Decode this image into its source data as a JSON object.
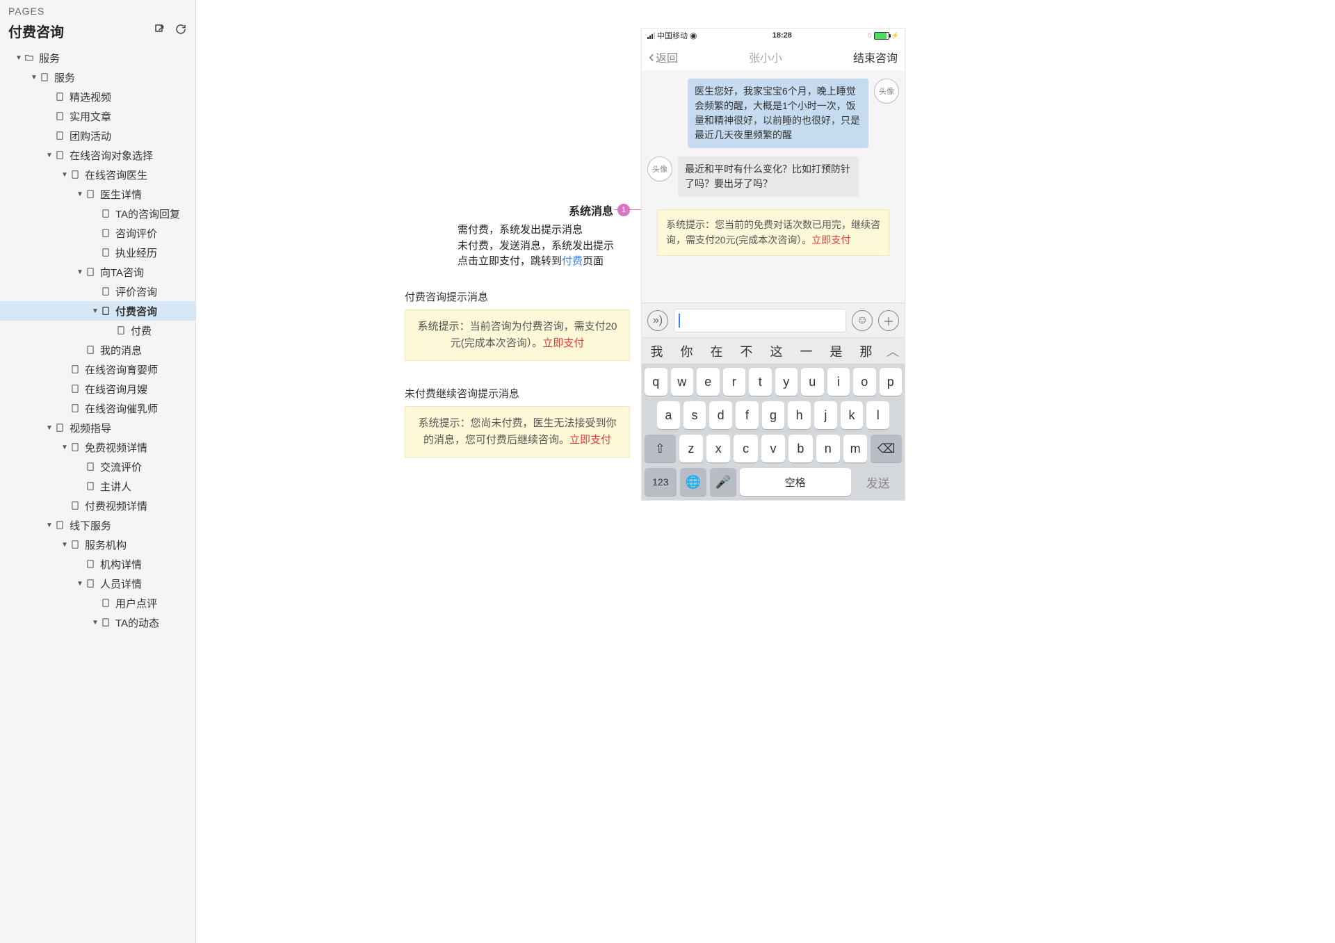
{
  "sidebar": {
    "pages_label": "PAGES",
    "title": "付费咨询",
    "tree": {
      "n0": "服务",
      "n1": "服务",
      "n2": "精选视频",
      "n3": "实用文章",
      "n4": "团购活动",
      "n5": "在线咨询对象选择",
      "n6": "在线咨询医生",
      "n7": "医生详情",
      "n8": "TA的咨询回复",
      "n9": "咨询评价",
      "n10": "执业经历",
      "n11": "向TA咨询",
      "n12": "评价咨询",
      "n13": "付费咨询",
      "n14": "付费",
      "n15": "我的消息",
      "n16": "在线咨询育婴师",
      "n17": "在线咨询月嫂",
      "n18": "在线咨询催乳师",
      "n19": "视频指导",
      "n20": "免费视频详情",
      "n21": "交流评价",
      "n22": "主讲人",
      "n23": "付费视频详情",
      "n24": "线下服务",
      "n25": "服务机构",
      "n26": "机构详情",
      "n27": "人员详情",
      "n28": "用户点评",
      "n29": "TA的动态"
    }
  },
  "annot": {
    "title": "系统消息",
    "badge": "1",
    "line1": "需付费，系统发出提示消息",
    "line2": "未付费，发送消息，系统发出提示",
    "line3a": "点击立即支付，跳转到",
    "line3b": "付费",
    "line3c": "页面",
    "sec1_title": "付费咨询提示消息",
    "sec1_text": "系统提示：当前咨询为付费咨询，需支付20元(完成本次咨询）。",
    "sec1_link": "立即支付",
    "sec2_title": "未付费继续咨询提示消息",
    "sec2_text": "系统提示：您尚未付费，医生无法接受到你的消息，您可付费后继续咨询。",
    "sec2_link": "立即支付"
  },
  "phone": {
    "carrier": "中国移动",
    "time": "18:28",
    "nav_back": "返回",
    "nav_title": "张小小",
    "nav_end": "结束咨询",
    "avatar": "头像",
    "msg1": "医生您好，我家宝宝6个月，晚上睡觉会频繁的醒，大概是1个小时一次，饭量和精神很好，以前睡的也很好，只是最近几天夜里频繁的醒",
    "msg2": "最近和平时有什么变化？比如打预防针了吗？要出牙了吗？",
    "sys_text": "系统提示：您当前的免费对话次数已用完，继续咨询，需支付20元(完成本次咨询）。",
    "sys_link": "立即支付",
    "suggest": [
      "我",
      "你",
      "在",
      "不",
      "这",
      "一",
      "是",
      "那"
    ],
    "krow1": [
      "q",
      "w",
      "e",
      "r",
      "t",
      "y",
      "u",
      "i",
      "o",
      "p"
    ],
    "krow2": [
      "a",
      "s",
      "d",
      "f",
      "g",
      "h",
      "j",
      "k",
      "l"
    ],
    "krow3": [
      "z",
      "x",
      "c",
      "v",
      "b",
      "n",
      "m"
    ],
    "k123": "123",
    "kspace": "空格",
    "ksend": "发送"
  }
}
